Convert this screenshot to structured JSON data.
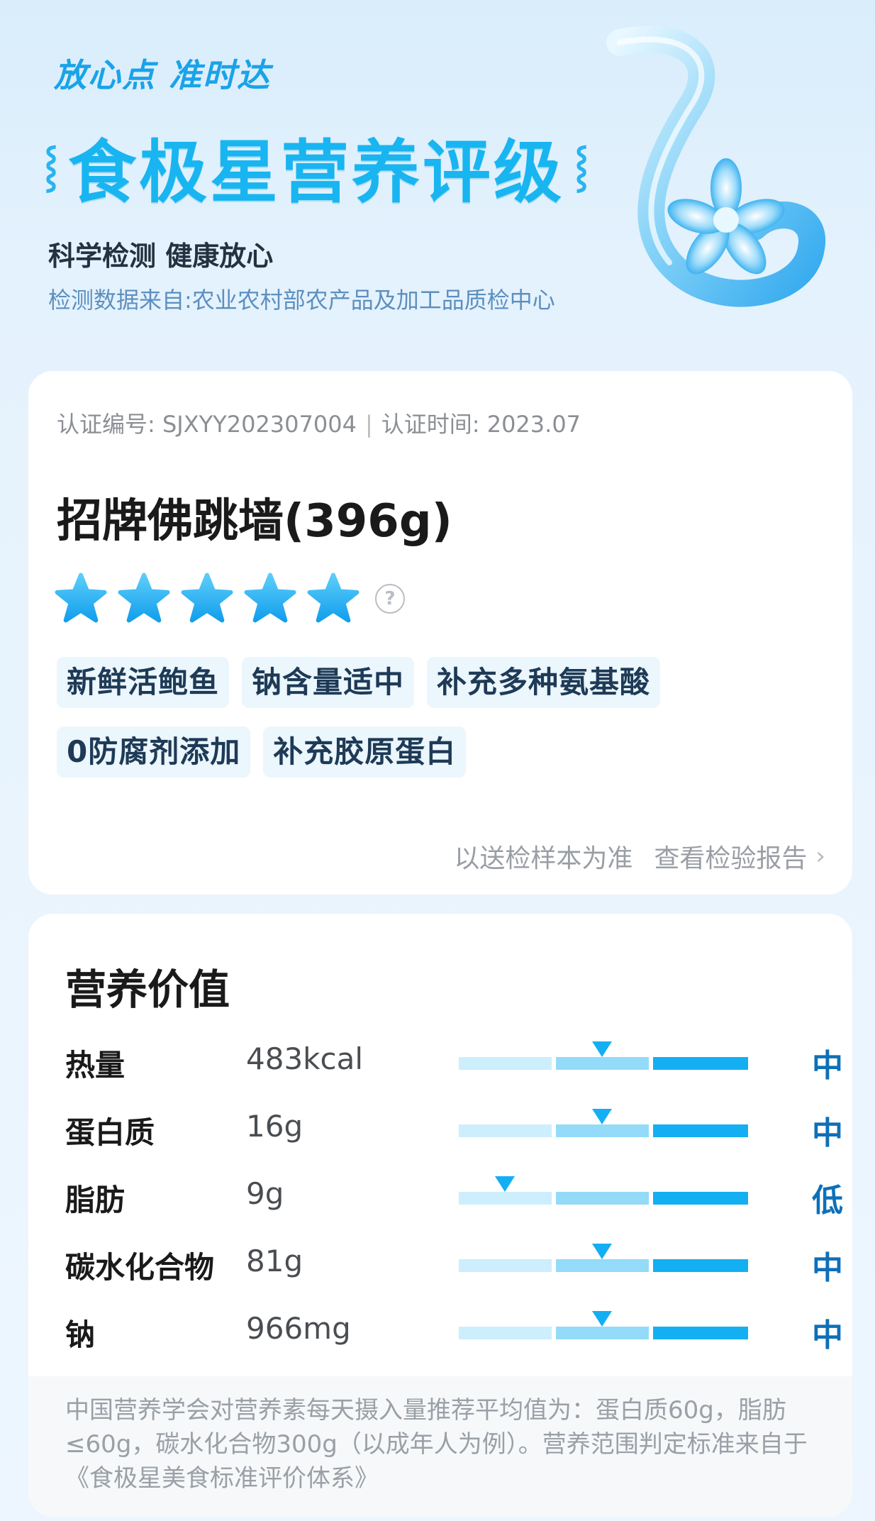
{
  "header": {
    "slogan": "放心点 准时达",
    "title": "食极星营养评级",
    "subtitle": "科学检测 健康放心",
    "source": "检测数据来自:农业农村部农产品及加工品质检中心"
  },
  "product_card": {
    "cert_number": "认证编号: SJXYY202307004",
    "separator": "|",
    "cert_time": "认证时间: 2023.07",
    "product_name": "招牌佛跳墙(396g)",
    "rating": 5,
    "rating_max": 5,
    "help_icon": "question-circle-icon",
    "tags": [
      "新鲜活鲍鱼",
      "钠含量适中",
      "补充多种氨基酸",
      "0防腐剂添加",
      "补充胶原蛋白"
    ],
    "sample_note": "以送检样本为准",
    "report_link": "查看检验报告",
    "chevron_icon": "chevron-right-icon"
  },
  "nutrition": {
    "title": "营养价值",
    "rows": [
      {
        "name": "热量",
        "value": "483kcal",
        "level": "中",
        "level_index": 1
      },
      {
        "name": "蛋白质",
        "value": "16g",
        "level": "中",
        "level_index": 1
      },
      {
        "name": "脂肪",
        "value": "9g",
        "level": "低",
        "level_index": 0
      },
      {
        "name": "碳水化合物",
        "value": "81g",
        "level": "中",
        "level_index": 1
      },
      {
        "name": "钠",
        "value": "966mg",
        "level": "中",
        "level_index": 1
      }
    ],
    "footnote": "中国营养学会对营养素每天摄入量推荐平均值为：蛋白质60g，脂肪≤60g，碳水化合物300g（以成年人为例）。营养范围判定标准来自于《食极星美食标准评价体系》"
  },
  "colors": {
    "accent": "#14aff2",
    "level_text": "#0e6fb8",
    "seg_low": "#cdeefc",
    "seg_mid": "#93dbf8",
    "seg_high": "#14aff2"
  }
}
